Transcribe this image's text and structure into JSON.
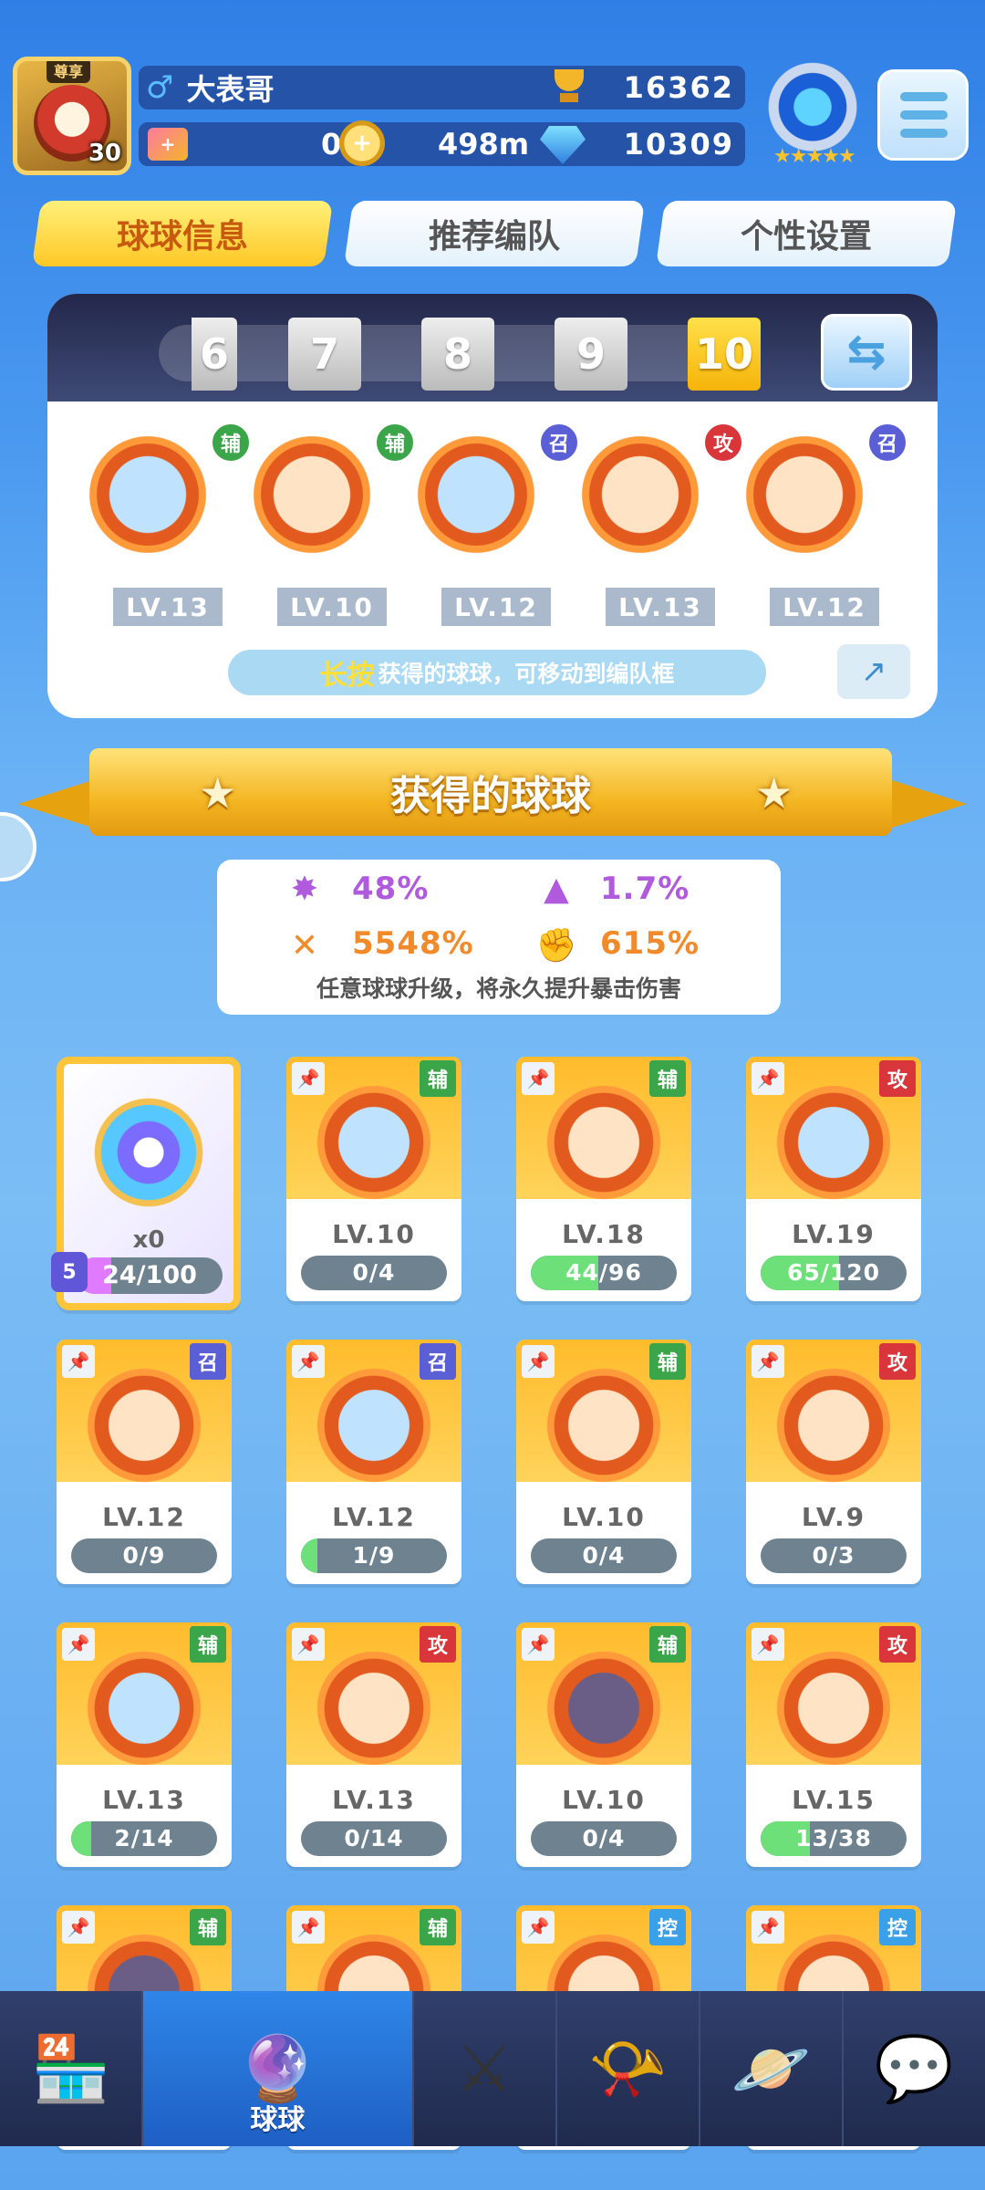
{
  "header": {
    "vip_badge": "尊享",
    "player_level": "30",
    "gender_icon": "male-symbol-icon",
    "player_name": "大表哥",
    "trophy_value": "16362",
    "tickets": "0",
    "distance": "498m",
    "diamonds": "10309"
  },
  "tabs": [
    {
      "label": "球球信息",
      "active": true
    },
    {
      "label": "推荐编队",
      "active": false
    },
    {
      "label": "个性设置",
      "active": false
    }
  ],
  "team": {
    "slots": [
      "6",
      "7",
      "8",
      "9",
      "10"
    ],
    "selected_slot": "10",
    "balls": [
      {
        "tag": "辅",
        "level": "LV.13"
      },
      {
        "tag": "辅",
        "level": "LV.10"
      },
      {
        "tag": "召",
        "level": "LV.12"
      },
      {
        "tag": "攻",
        "level": "LV.13"
      },
      {
        "tag": "召",
        "level": "LV.12"
      }
    ],
    "hint_highlight": "长按",
    "hint_text": "获得的球球，可移动到编队框"
  },
  "section_title": "获得的球球",
  "stats": {
    "s1": "48%",
    "s2": "1.7%",
    "s3": "5548%",
    "s4": "615%",
    "note": "任意球球升级，将永久提升暴击伤害",
    "colors": {
      "purple": "#b05bde",
      "orange": "#f08a2a"
    }
  },
  "special_card": {
    "count": "x0",
    "progress": "24/100",
    "fill": 0.24
  },
  "cards": [
    {
      "tag": "辅",
      "tag_color": "green",
      "level": "LV.10",
      "progress": "0/4",
      "fill": 0
    },
    {
      "tag": "辅",
      "tag_color": "green",
      "level": "LV.18",
      "progress": "44/96",
      "fill": 0.46
    },
    {
      "tag": "攻",
      "tag_color": "red",
      "level": "LV.19",
      "progress": "65/120",
      "fill": 0.54
    },
    {
      "tag": "召",
      "tag_color": "blue",
      "level": "LV.12",
      "progress": "0/9",
      "fill": 0
    },
    {
      "tag": "召",
      "tag_color": "blue",
      "level": "LV.12",
      "progress": "1/9",
      "fill": 0.11
    },
    {
      "tag": "辅",
      "tag_color": "green",
      "level": "LV.10",
      "progress": "0/4",
      "fill": 0
    },
    {
      "tag": "攻",
      "tag_color": "red",
      "level": "LV.9",
      "progress": "0/3",
      "fill": 0
    },
    {
      "tag": "辅",
      "tag_color": "green",
      "level": "LV.13",
      "progress": "2/14",
      "fill": 0.14
    },
    {
      "tag": "攻",
      "tag_color": "red",
      "level": "LV.13",
      "progress": "0/14",
      "fill": 0
    },
    {
      "tag": "辅",
      "tag_color": "green",
      "level": "LV.10",
      "progress": "0/4",
      "fill": 0
    },
    {
      "tag": "攻",
      "tag_color": "red",
      "level": "LV.15",
      "progress": "13/38",
      "fill": 0.34
    },
    {
      "tag": "辅",
      "tag_color": "green"
    },
    {
      "tag": "辅",
      "tag_color": "green"
    },
    {
      "tag": "控",
      "tag_color": "teal"
    },
    {
      "tag": "控",
      "tag_color": "teal"
    }
  ],
  "nav": {
    "items": [
      "shop-icon",
      "ball-icon",
      "battle-icon",
      "whistle-icon",
      "planet-icon",
      "chat-icon"
    ],
    "active_label": "球球"
  }
}
